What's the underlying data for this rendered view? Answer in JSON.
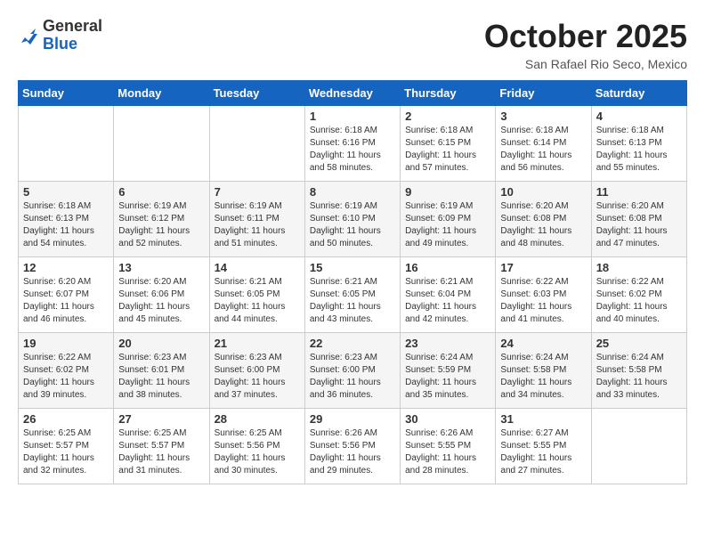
{
  "header": {
    "logo_general": "General",
    "logo_blue": "Blue",
    "month_title": "October 2025",
    "location": "San Rafael Rio Seco, Mexico"
  },
  "weekdays": [
    "Sunday",
    "Monday",
    "Tuesday",
    "Wednesday",
    "Thursday",
    "Friday",
    "Saturday"
  ],
  "weeks": [
    [
      {
        "day": "",
        "sunrise": "",
        "sunset": "",
        "daylight": ""
      },
      {
        "day": "",
        "sunrise": "",
        "sunset": "",
        "daylight": ""
      },
      {
        "day": "",
        "sunrise": "",
        "sunset": "",
        "daylight": ""
      },
      {
        "day": "1",
        "sunrise": "Sunrise: 6:18 AM",
        "sunset": "Sunset: 6:16 PM",
        "daylight": "Daylight: 11 hours and 58 minutes."
      },
      {
        "day": "2",
        "sunrise": "Sunrise: 6:18 AM",
        "sunset": "Sunset: 6:15 PM",
        "daylight": "Daylight: 11 hours and 57 minutes."
      },
      {
        "day": "3",
        "sunrise": "Sunrise: 6:18 AM",
        "sunset": "Sunset: 6:14 PM",
        "daylight": "Daylight: 11 hours and 56 minutes."
      },
      {
        "day": "4",
        "sunrise": "Sunrise: 6:18 AM",
        "sunset": "Sunset: 6:13 PM",
        "daylight": "Daylight: 11 hours and 55 minutes."
      }
    ],
    [
      {
        "day": "5",
        "sunrise": "Sunrise: 6:18 AM",
        "sunset": "Sunset: 6:13 PM",
        "daylight": "Daylight: 11 hours and 54 minutes."
      },
      {
        "day": "6",
        "sunrise": "Sunrise: 6:19 AM",
        "sunset": "Sunset: 6:12 PM",
        "daylight": "Daylight: 11 hours and 52 minutes."
      },
      {
        "day": "7",
        "sunrise": "Sunrise: 6:19 AM",
        "sunset": "Sunset: 6:11 PM",
        "daylight": "Daylight: 11 hours and 51 minutes."
      },
      {
        "day": "8",
        "sunrise": "Sunrise: 6:19 AM",
        "sunset": "Sunset: 6:10 PM",
        "daylight": "Daylight: 11 hours and 50 minutes."
      },
      {
        "day": "9",
        "sunrise": "Sunrise: 6:19 AM",
        "sunset": "Sunset: 6:09 PM",
        "daylight": "Daylight: 11 hours and 49 minutes."
      },
      {
        "day": "10",
        "sunrise": "Sunrise: 6:20 AM",
        "sunset": "Sunset: 6:08 PM",
        "daylight": "Daylight: 11 hours and 48 minutes."
      },
      {
        "day": "11",
        "sunrise": "Sunrise: 6:20 AM",
        "sunset": "Sunset: 6:08 PM",
        "daylight": "Daylight: 11 hours and 47 minutes."
      }
    ],
    [
      {
        "day": "12",
        "sunrise": "Sunrise: 6:20 AM",
        "sunset": "Sunset: 6:07 PM",
        "daylight": "Daylight: 11 hours and 46 minutes."
      },
      {
        "day": "13",
        "sunrise": "Sunrise: 6:20 AM",
        "sunset": "Sunset: 6:06 PM",
        "daylight": "Daylight: 11 hours and 45 minutes."
      },
      {
        "day": "14",
        "sunrise": "Sunrise: 6:21 AM",
        "sunset": "Sunset: 6:05 PM",
        "daylight": "Daylight: 11 hours and 44 minutes."
      },
      {
        "day": "15",
        "sunrise": "Sunrise: 6:21 AM",
        "sunset": "Sunset: 6:05 PM",
        "daylight": "Daylight: 11 hours and 43 minutes."
      },
      {
        "day": "16",
        "sunrise": "Sunrise: 6:21 AM",
        "sunset": "Sunset: 6:04 PM",
        "daylight": "Daylight: 11 hours and 42 minutes."
      },
      {
        "day": "17",
        "sunrise": "Sunrise: 6:22 AM",
        "sunset": "Sunset: 6:03 PM",
        "daylight": "Daylight: 11 hours and 41 minutes."
      },
      {
        "day": "18",
        "sunrise": "Sunrise: 6:22 AM",
        "sunset": "Sunset: 6:02 PM",
        "daylight": "Daylight: 11 hours and 40 minutes."
      }
    ],
    [
      {
        "day": "19",
        "sunrise": "Sunrise: 6:22 AM",
        "sunset": "Sunset: 6:02 PM",
        "daylight": "Daylight: 11 hours and 39 minutes."
      },
      {
        "day": "20",
        "sunrise": "Sunrise: 6:23 AM",
        "sunset": "Sunset: 6:01 PM",
        "daylight": "Daylight: 11 hours and 38 minutes."
      },
      {
        "day": "21",
        "sunrise": "Sunrise: 6:23 AM",
        "sunset": "Sunset: 6:00 PM",
        "daylight": "Daylight: 11 hours and 37 minutes."
      },
      {
        "day": "22",
        "sunrise": "Sunrise: 6:23 AM",
        "sunset": "Sunset: 6:00 PM",
        "daylight": "Daylight: 11 hours and 36 minutes."
      },
      {
        "day": "23",
        "sunrise": "Sunrise: 6:24 AM",
        "sunset": "Sunset: 5:59 PM",
        "daylight": "Daylight: 11 hours and 35 minutes."
      },
      {
        "day": "24",
        "sunrise": "Sunrise: 6:24 AM",
        "sunset": "Sunset: 5:58 PM",
        "daylight": "Daylight: 11 hours and 34 minutes."
      },
      {
        "day": "25",
        "sunrise": "Sunrise: 6:24 AM",
        "sunset": "Sunset: 5:58 PM",
        "daylight": "Daylight: 11 hours and 33 minutes."
      }
    ],
    [
      {
        "day": "26",
        "sunrise": "Sunrise: 6:25 AM",
        "sunset": "Sunset: 5:57 PM",
        "daylight": "Daylight: 11 hours and 32 minutes."
      },
      {
        "day": "27",
        "sunrise": "Sunrise: 6:25 AM",
        "sunset": "Sunset: 5:57 PM",
        "daylight": "Daylight: 11 hours and 31 minutes."
      },
      {
        "day": "28",
        "sunrise": "Sunrise: 6:25 AM",
        "sunset": "Sunset: 5:56 PM",
        "daylight": "Daylight: 11 hours and 30 minutes."
      },
      {
        "day": "29",
        "sunrise": "Sunrise: 6:26 AM",
        "sunset": "Sunset: 5:56 PM",
        "daylight": "Daylight: 11 hours and 29 minutes."
      },
      {
        "day": "30",
        "sunrise": "Sunrise: 6:26 AM",
        "sunset": "Sunset: 5:55 PM",
        "daylight": "Daylight: 11 hours and 28 minutes."
      },
      {
        "day": "31",
        "sunrise": "Sunrise: 6:27 AM",
        "sunset": "Sunset: 5:55 PM",
        "daylight": "Daylight: 11 hours and 27 minutes."
      },
      {
        "day": "",
        "sunrise": "",
        "sunset": "",
        "daylight": ""
      }
    ]
  ]
}
